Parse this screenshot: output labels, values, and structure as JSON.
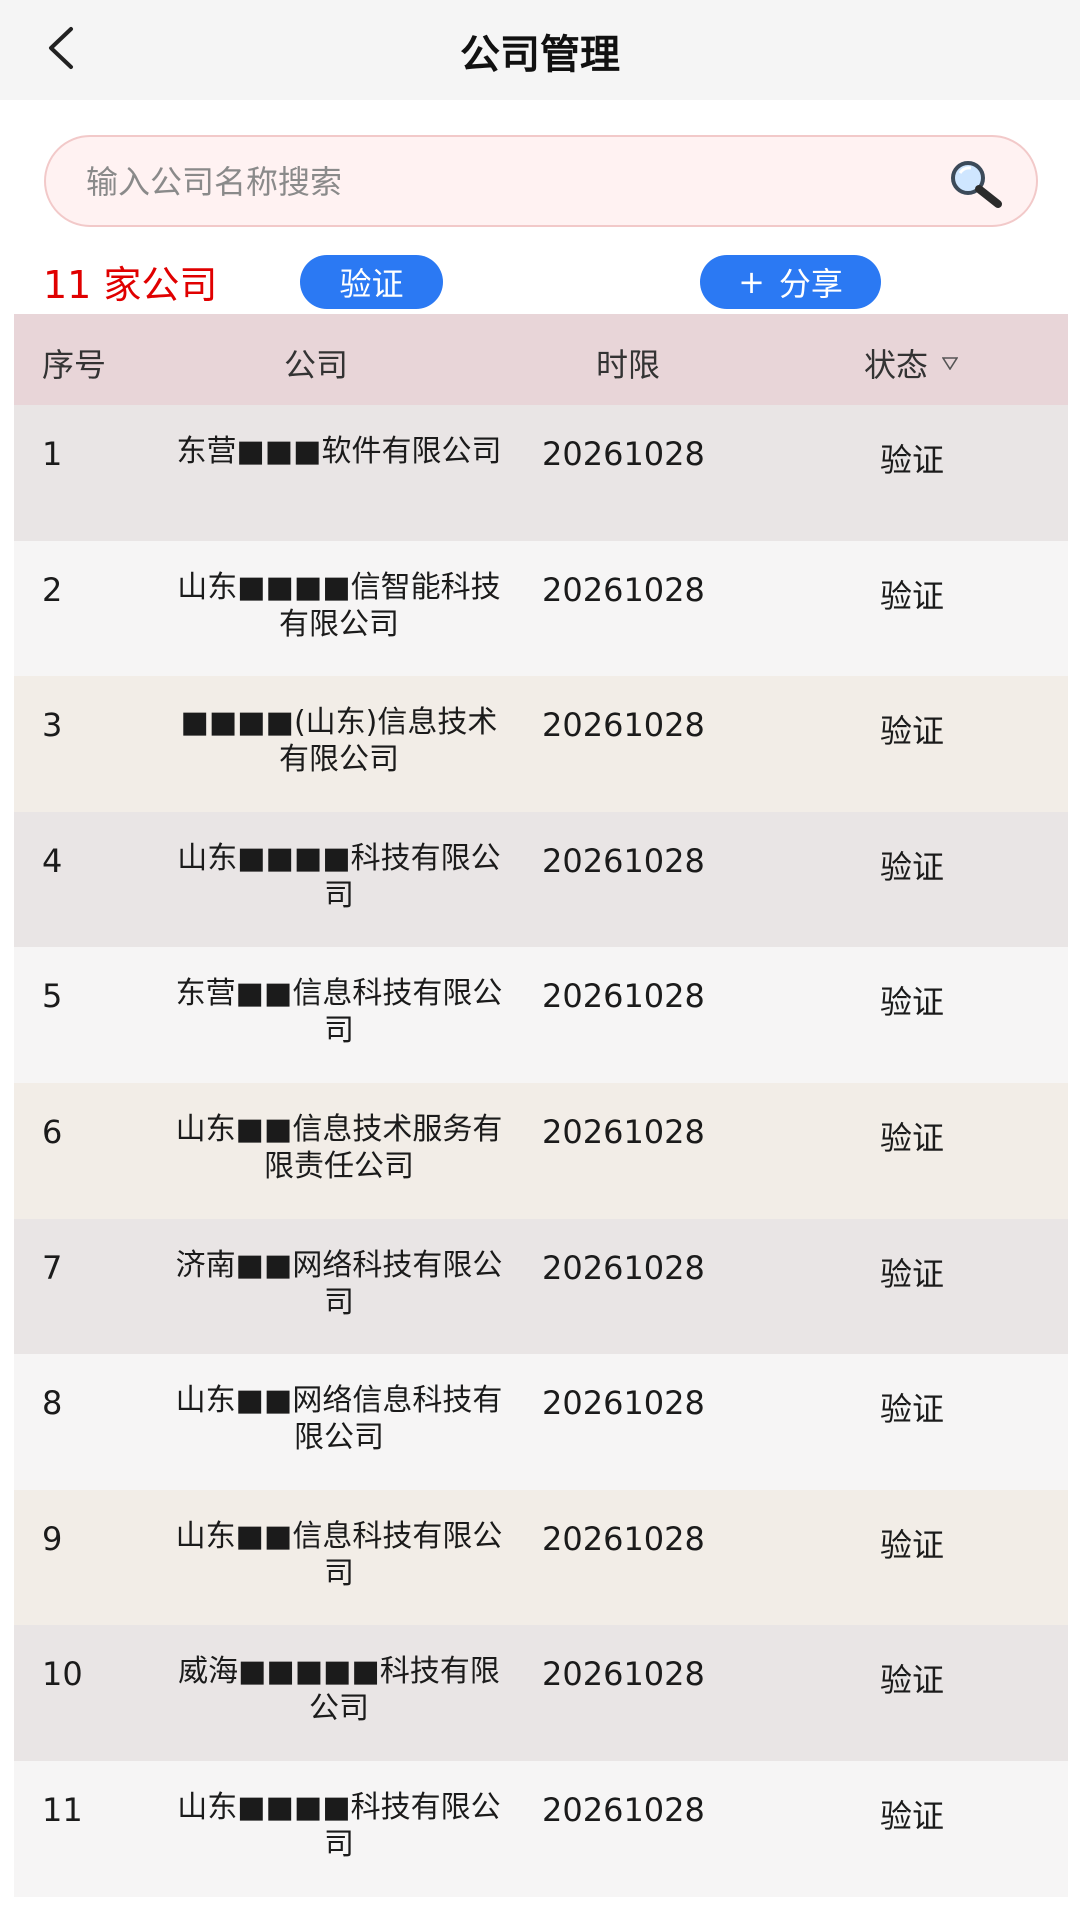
{
  "header": {
    "title": "公司管理"
  },
  "search": {
    "placeholder": "输入公司名称搜索"
  },
  "summary": {
    "count_label": "11 家公司"
  },
  "actions": {
    "verify_label": "验证",
    "share_plus": "+",
    "share_label": "分享"
  },
  "table": {
    "columns": {
      "index": "序号",
      "company": "公司",
      "term": "时限",
      "status": "状态"
    },
    "rows": [
      {
        "index": "1",
        "company": "东营■■■软件有限公司",
        "term": "20261028",
        "status": "验证"
      },
      {
        "index": "2",
        "company": "山东■■■■信智能科技有限公司",
        "term": "20261028",
        "status": "验证"
      },
      {
        "index": "3",
        "company": "■■■■(山东)信息技术有限公司",
        "term": "20261028",
        "status": "验证"
      },
      {
        "index": "4",
        "company": "山东■■■■科技有限公司",
        "term": "20261028",
        "status": "验证"
      },
      {
        "index": "5",
        "company": "东营■■信息科技有限公司",
        "term": "20261028",
        "status": "验证"
      },
      {
        "index": "6",
        "company": "山东■■信息技术服务有限责任公司",
        "term": "20261028",
        "status": "验证"
      },
      {
        "index": "7",
        "company": "济南■■网络科技有限公司",
        "term": "20261028",
        "status": "验证"
      },
      {
        "index": "8",
        "company": "山东■■网络信息科技有限公司",
        "term": "20261028",
        "status": "验证"
      },
      {
        "index": "9",
        "company": "山东■■信息科技有限公司",
        "term": "20261028",
        "status": "验证"
      },
      {
        "index": "10",
        "company": "威海■■■■■科技有限公司",
        "term": "20261028",
        "status": "验证"
      },
      {
        "index": "11",
        "company": "山东■■■■科技有限公司",
        "term": "20261028",
        "status": "验证"
      }
    ]
  },
  "icons": {
    "back": "chevron-left-icon",
    "search": "magnifier-icon",
    "sort": "sort-down-triangle-icon"
  },
  "colors": {
    "accent_blue": "#2b79f3",
    "count_red": "#e00000",
    "header_row": "#e8d5d8"
  }
}
